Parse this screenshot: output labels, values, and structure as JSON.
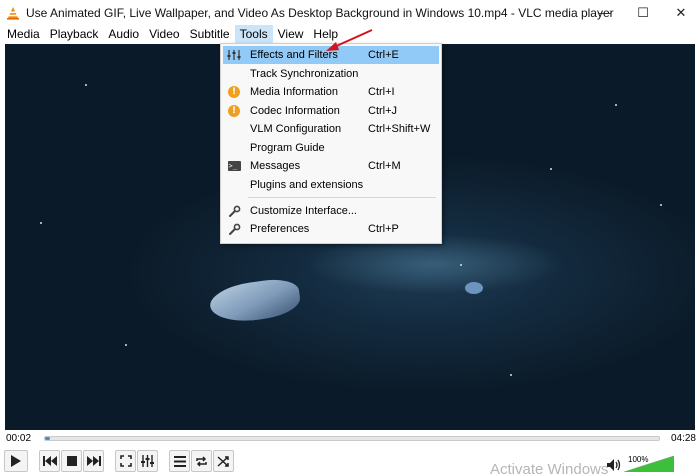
{
  "window": {
    "title": "Use Animated GIF, Live Wallpaper, and Video As Desktop Background in Windows 10.mp4 - VLC media player",
    "controls": {
      "minimize": "—",
      "maximize": "☐",
      "close": "✕"
    }
  },
  "menubar": {
    "items": [
      "Media",
      "Playback",
      "Audio",
      "Video",
      "Subtitle",
      "Tools",
      "View",
      "Help"
    ],
    "active": "Tools"
  },
  "tools_menu": {
    "items": [
      {
        "label": "Effects and Filters",
        "shortcut": "Ctrl+E",
        "icon": "sliders-icon",
        "highlighted": true
      },
      {
        "label": "Track Synchronization",
        "shortcut": "",
        "icon": ""
      },
      {
        "label": "Media Information",
        "shortcut": "Ctrl+I",
        "icon": "info-icon"
      },
      {
        "label": "Codec Information",
        "shortcut": "Ctrl+J",
        "icon": "info-icon"
      },
      {
        "label": "VLM Configuration",
        "shortcut": "Ctrl+Shift+W",
        "icon": ""
      },
      {
        "label": "Program Guide",
        "shortcut": "",
        "icon": ""
      },
      {
        "label": "Messages",
        "shortcut": "Ctrl+M",
        "icon": "terminal-icon"
      },
      {
        "label": "Plugins and extensions",
        "shortcut": "",
        "icon": ""
      },
      {
        "label": "Customize Interface...",
        "shortcut": "",
        "icon": "wrench-icon"
      },
      {
        "label": "Preferences",
        "shortcut": "Ctrl+P",
        "icon": "wrench-icon"
      }
    ]
  },
  "playback": {
    "current_time": "00:02",
    "total_time": "04:28",
    "progress_fraction": 0.0075
  },
  "volume": {
    "label": "100%",
    "level_fraction": 1.0
  },
  "watermark": "Activate Windows",
  "colors": {
    "menu_highlight": "#91c9f7",
    "seek_fill": "#3a8ee6",
    "volume_green": "#3cc03c",
    "info_orange": "#f0a020",
    "arrow_red": "#d6121b"
  }
}
